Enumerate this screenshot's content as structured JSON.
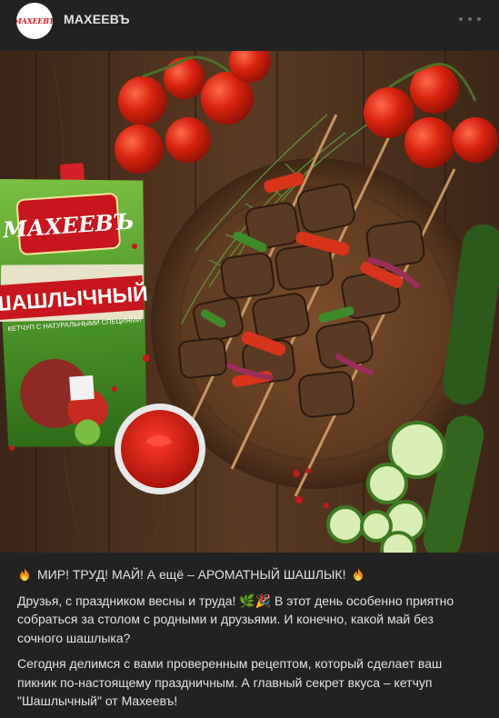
{
  "post": {
    "author": "МАХЕЕВЪ",
    "avatar_logo_text": "МАХЕЕВЪ",
    "headline": "МИР! ТРУД! МАЙ! А ещё – АРОМАТНЫЙ ШАШЛЫК!",
    "paragraph1": "Друзья, с праздником весны и труда! 🌿🎉 В этот день особенно приятно собраться за столом с родными и друзьями. И конечно, какой май без сочного шашлыка?",
    "paragraph2": "Сегодня делимся с вами проверенным рецептом, который сделает ваш пикник по-настоящему праздничным. А главный секрет вкуса – кетчуп \"Шашлычный\" от Махеевъ!"
  },
  "photo": {
    "package_brand": "МАХЕЕВЪ",
    "package_product": "ШАШЛЫЧНЫЙ",
    "package_subtitle": "КЕТЧУП С НАТУРАЛЬНЫМИ СПЕЦИЯМИ"
  },
  "icons": {
    "headline_left": "fire-icon",
    "headline_right": "fire-icon",
    "more": "more-dots-icon"
  },
  "colors": {
    "background": "#222222",
    "text": "#e1e3e6",
    "brand_red": "#d31f26",
    "package_green": "#4f9a2c"
  }
}
